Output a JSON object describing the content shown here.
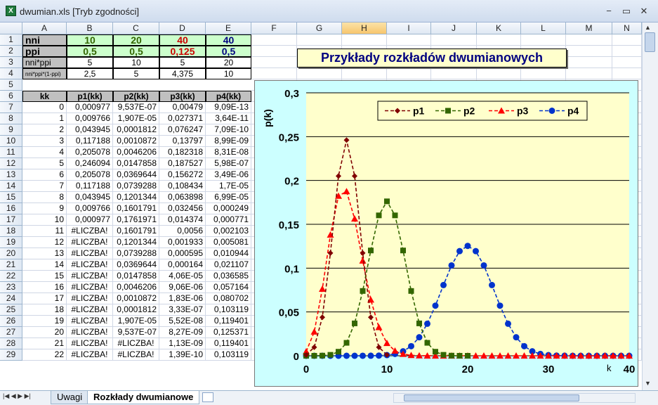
{
  "window": {
    "title": "dwumian.xls  [Tryb zgodności]",
    "min": "−",
    "max": "▭",
    "close": "✕"
  },
  "columns": [
    "A",
    "B",
    "C",
    "D",
    "E",
    "F",
    "G",
    "H",
    "I",
    "J",
    "K",
    "L",
    "M",
    "N"
  ],
  "rows": [
    "1",
    "2",
    "3",
    "4",
    "5",
    "6",
    "7",
    "8",
    "9",
    "10",
    "11",
    "12",
    "13",
    "14",
    "15",
    "16",
    "17",
    "18",
    "19",
    "20",
    "21",
    "22",
    "23",
    "24",
    "25",
    "26",
    "27",
    "28",
    "29"
  ],
  "params": {
    "nni": {
      "label": "nni",
      "v": [
        "10",
        "20",
        "40",
        "40"
      ]
    },
    "ppi": {
      "label": "ppi",
      "v": [
        "0,5",
        "0,5",
        "0,125",
        "0,5"
      ]
    },
    "mean": {
      "label": "nni*ppi",
      "v": [
        "5",
        "10",
        "5",
        "20"
      ]
    },
    "var": {
      "label": "nni*ppi*(1-ppi)",
      "v": [
        "2,5",
        "5",
        "4,375",
        "10"
      ]
    }
  },
  "table": {
    "headers": [
      "kk",
      "p1(kk)",
      "p2(kk)",
      "p3(kk)",
      "p4(kk)"
    ],
    "rows": [
      [
        "0",
        "0,000977",
        "9,537E-07",
        "0,00479",
        "9,09E-13"
      ],
      [
        "1",
        "0,009766",
        "1,907E-05",
        "0,027371",
        "3,64E-11"
      ],
      [
        "2",
        "0,043945",
        "0,0001812",
        "0,076247",
        "7,09E-10"
      ],
      [
        "3",
        "0,117188",
        "0,0010872",
        "0,13797",
        "8,99E-09"
      ],
      [
        "4",
        "0,205078",
        "0,0046206",
        "0,182318",
        "8,31E-08"
      ],
      [
        "5",
        "0,246094",
        "0,0147858",
        "0,187527",
        "5,98E-07"
      ],
      [
        "6",
        "0,205078",
        "0,0369644",
        "0,156272",
        "3,49E-06"
      ],
      [
        "7",
        "0,117188",
        "0,0739288",
        "0,108434",
        "1,7E-05"
      ],
      [
        "8",
        "0,043945",
        "0,1201344",
        "0,063898",
        "6,99E-05"
      ],
      [
        "9",
        "0,009766",
        "0,1601791",
        "0,032456",
        "0,000249"
      ],
      [
        "10",
        "0,000977",
        "0,1761971",
        "0,014374",
        "0,000771"
      ],
      [
        "11",
        "#LICZBA!",
        "0,1601791",
        "0,0056",
        "0,002103"
      ],
      [
        "12",
        "#LICZBA!",
        "0,1201344",
        "0,001933",
        "0,005081"
      ],
      [
        "13",
        "#LICZBA!",
        "0,0739288",
        "0,000595",
        "0,010944"
      ],
      [
        "14",
        "#LICZBA!",
        "0,0369644",
        "0,000164",
        "0,021107"
      ],
      [
        "15",
        "#LICZBA!",
        "0,0147858",
        "4,06E-05",
        "0,036585"
      ],
      [
        "16",
        "#LICZBA!",
        "0,0046206",
        "9,06E-06",
        "0,057164"
      ],
      [
        "17",
        "#LICZBA!",
        "0,0010872",
        "1,83E-06",
        "0,080702"
      ],
      [
        "18",
        "#LICZBA!",
        "0,0001812",
        "3,33E-07",
        "0,103119"
      ],
      [
        "19",
        "#LICZBA!",
        "1,907E-05",
        "5,52E-08",
        "0,119401"
      ],
      [
        "20",
        "#LICZBA!",
        "9,537E-07",
        "8,27E-09",
        "0,125371"
      ],
      [
        "21",
        "#LICZBA!",
        "#LICZBA!",
        "1,13E-09",
        "0,119401"
      ],
      [
        "22",
        "#LICZBA!",
        "#LICZBA!",
        "1,39E-10",
        "0,103119"
      ]
    ]
  },
  "chart_data": {
    "type": "line",
    "title": "Przykłady rozkładów dwumianowych",
    "ylabel": "p(k)",
    "xlabel": "k",
    "xlim": [
      0,
      40
    ],
    "ylim": [
      0,
      0.3
    ],
    "yticks": [
      "0",
      "0,05",
      "0,1",
      "0,15",
      "0,2",
      "0,25",
      "0,3"
    ],
    "xticks": [
      "0",
      "10",
      "20",
      "30",
      "40"
    ],
    "legend": "top",
    "series": [
      {
        "name": "p1",
        "color": "#800000",
        "marker": "diamond",
        "x": [
          0,
          1,
          2,
          3,
          4,
          5,
          6,
          7,
          8,
          9,
          10
        ],
        "values": [
          0.000977,
          0.009766,
          0.043945,
          0.117188,
          0.205078,
          0.246094,
          0.205078,
          0.117188,
          0.043945,
          0.009766,
          0.000977
        ]
      },
      {
        "name": "p2",
        "color": "#336600",
        "marker": "square",
        "x": [
          0,
          1,
          2,
          3,
          4,
          5,
          6,
          7,
          8,
          9,
          10,
          11,
          12,
          13,
          14,
          15,
          16,
          17,
          18,
          19,
          20
        ],
        "values": [
          9.537e-07,
          1.907e-05,
          0.0001812,
          0.0010872,
          0.0046206,
          0.0147858,
          0.0369644,
          0.0739288,
          0.1201344,
          0.1601791,
          0.1761971,
          0.1601791,
          0.1201344,
          0.0739288,
          0.0369644,
          0.0147858,
          0.0046206,
          0.0010872,
          0.0001812,
          1.907e-05,
          9.537e-07
        ]
      },
      {
        "name": "p3",
        "color": "#ff0000",
        "marker": "triangle",
        "x": [
          0,
          1,
          2,
          3,
          4,
          5,
          6,
          7,
          8,
          9,
          10,
          11,
          12,
          13,
          14,
          15,
          16,
          17,
          18,
          19,
          20,
          21,
          22,
          23,
          24,
          25,
          26,
          27,
          28,
          29,
          30,
          31,
          32,
          33,
          34,
          35,
          36,
          37,
          38,
          39,
          40
        ],
        "values": [
          0.00479,
          0.027371,
          0.076247,
          0.13797,
          0.182318,
          0.187527,
          0.156272,
          0.108434,
          0.063898,
          0.032456,
          0.014374,
          0.0056,
          0.001933,
          0.000595,
          0.000164,
          4.06e-05,
          9.06e-06,
          1.83e-06,
          3.33e-07,
          5.52e-08,
          8.27e-09,
          0,
          0,
          0,
          0,
          0,
          0,
          0,
          0,
          0,
          0,
          0,
          0,
          0,
          0,
          0,
          0,
          0,
          0,
          0,
          0
        ]
      },
      {
        "name": "p4",
        "color": "#0033cc",
        "marker": "circle",
        "x": [
          0,
          1,
          2,
          3,
          4,
          5,
          6,
          7,
          8,
          9,
          10,
          11,
          12,
          13,
          14,
          15,
          16,
          17,
          18,
          19,
          20,
          21,
          22,
          23,
          24,
          25,
          26,
          27,
          28,
          29,
          30,
          31,
          32,
          33,
          34,
          35,
          36,
          37,
          38,
          39,
          40
        ],
        "values": [
          0,
          0,
          0,
          0,
          0,
          0,
          3.5e-06,
          1.7e-05,
          7e-05,
          0.000249,
          0.000771,
          0.002103,
          0.005081,
          0.010944,
          0.021107,
          0.036585,
          0.057164,
          0.080702,
          0.103119,
          0.119401,
          0.125371,
          0.119401,
          0.103119,
          0.080702,
          0.057164,
          0.036585,
          0.021107,
          0.010944,
          0.005081,
          0.002103,
          0.000771,
          0.000249,
          7e-05,
          1.7e-05,
          3.5e-06,
          0,
          0,
          0,
          0,
          0,
          0
        ]
      }
    ]
  },
  "sheet_tabs": [
    "Uwagi",
    "Rozkłady dwumianowe"
  ]
}
